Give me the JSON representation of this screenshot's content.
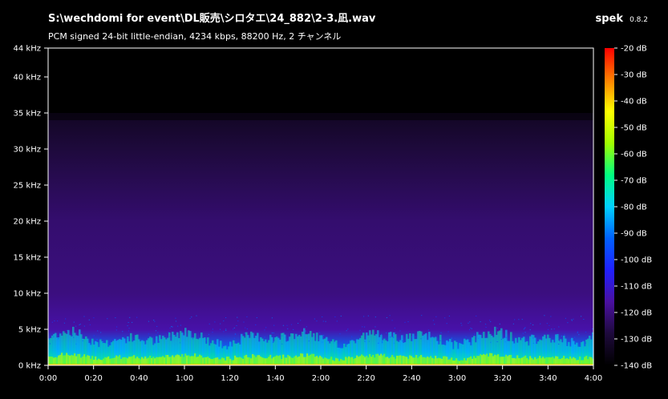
{
  "window": {
    "title": "S:\\wechdomi for event\\DL販売\\シロタエ\\24_882\\2-3.凪.wav",
    "info": "PCM signed 24-bit little-endian, 4234 kbps, 88200 Hz, 2 チャンネル",
    "app_name": "spek",
    "app_version": "0.8.2"
  },
  "colors": {
    "background": "#000000",
    "axis": "#ffffff"
  },
  "chart_data": {
    "type": "heatmap",
    "x_axis": {
      "unit": "time",
      "range": [
        0,
        240
      ],
      "ticks": [
        "0:00",
        "0:20",
        "0:40",
        "1:00",
        "1:20",
        "1:40",
        "2:00",
        "2:20",
        "2:40",
        "3:00",
        "3:20",
        "3:40",
        "4:00"
      ]
    },
    "y_axis": {
      "unit": "kHz",
      "range": [
        0,
        44
      ],
      "ticks": [
        "0 kHz",
        "5 kHz",
        "10 kHz",
        "15 kHz",
        "20 kHz",
        "25 kHz",
        "30 kHz",
        "35 kHz",
        "40 kHz",
        "44 kHz"
      ]
    },
    "color_scale": {
      "range_db": [
        -140,
        -20
      ],
      "ticks": [
        "-20 dB",
        "-30 dB",
        "-40 dB",
        "-50 dB",
        "-60 dB",
        "-70 dB",
        "-80 dB",
        "-90 dB",
        "-100 dB",
        "-110 dB",
        "-120 dB",
        "-130 dB",
        "-140 dB"
      ],
      "gradient": [
        "#000000",
        "#1e0a3c",
        "#4a10a0",
        "#2020ff",
        "#0060ff",
        "#00d0ff",
        "#00ff80",
        "#a0ff00",
        "#ffff00",
        "#ff8000",
        "#ff0000"
      ]
    },
    "content_cutoff_khz": 35,
    "levels_db": [
      {
        "khz": 0,
        "db": -65
      },
      {
        "khz": 2,
        "db": -90
      },
      {
        "khz": 5,
        "db": -115
      },
      {
        "khz": 10,
        "db": -120
      },
      {
        "khz": 20,
        "db": -122
      },
      {
        "khz": 30,
        "db": -128
      },
      {
        "khz": 35,
        "db": -133
      }
    ]
  }
}
